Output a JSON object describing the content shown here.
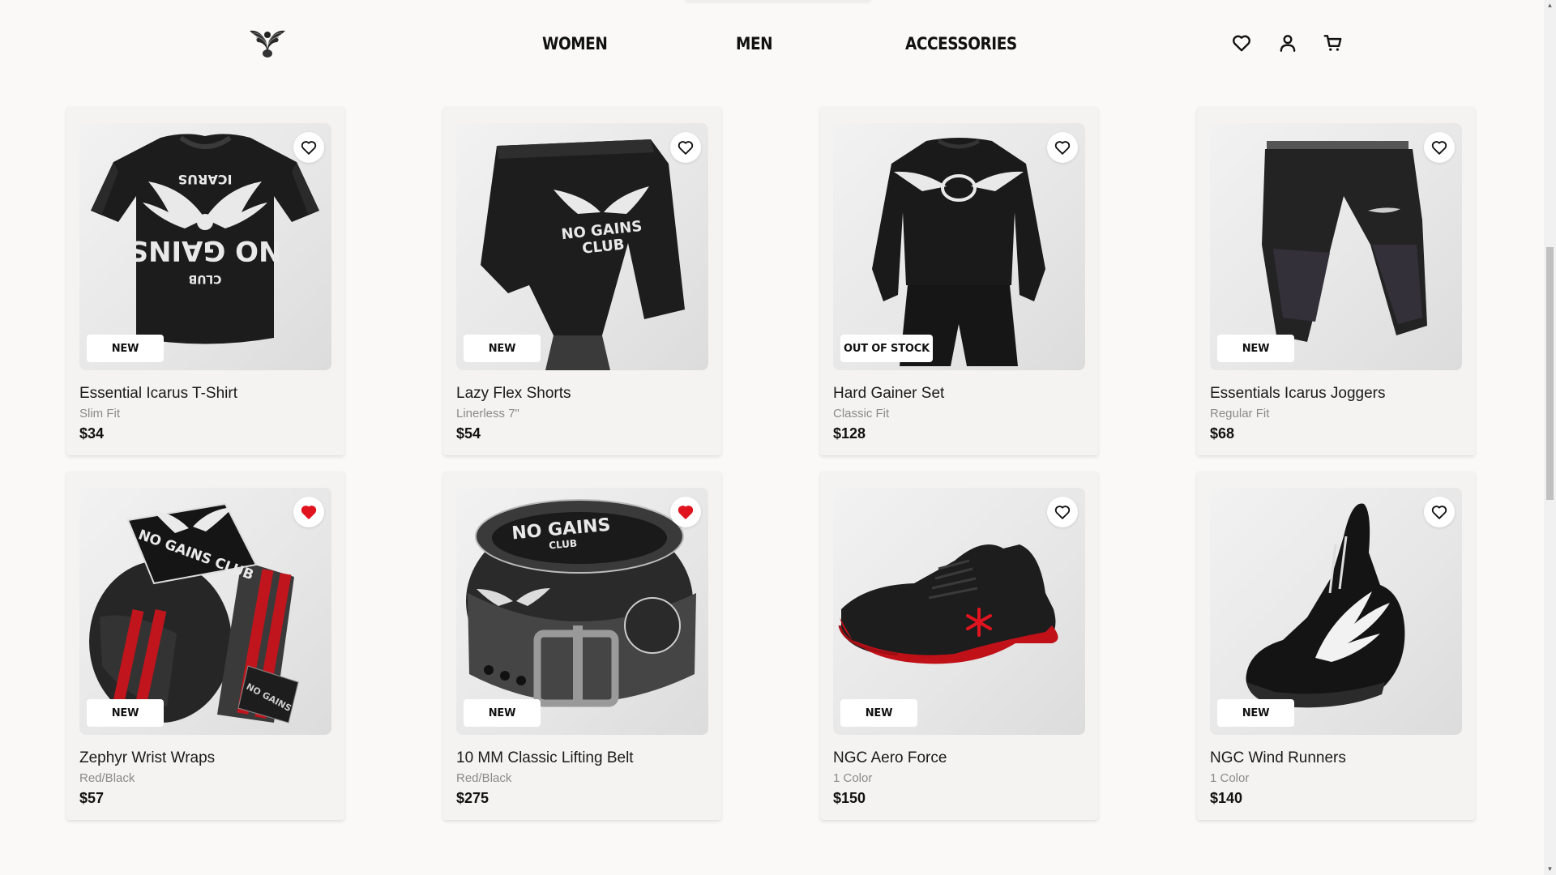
{
  "nav": {
    "logo": "eagle-logo",
    "links": [
      "WOMEN",
      "MEN",
      "ACCESSORIES"
    ],
    "icons": [
      "heart-icon",
      "user-icon",
      "cart-icon"
    ]
  },
  "products": [
    {
      "name": "Essential Icarus T-Shirt",
      "sub": "Slim Fit",
      "price": "$34",
      "badge": "NEW",
      "favorited": false
    },
    {
      "name": "Lazy Flex Shorts",
      "sub": "Linerless 7\"",
      "price": "$54",
      "badge": "NEW",
      "favorited": false
    },
    {
      "name": "Hard Gainer Set",
      "sub": "Classic Fit",
      "price": "$128",
      "badge": "OUT OF STOCK",
      "favorited": false
    },
    {
      "name": "Essentials Icarus Joggers",
      "sub": "Regular Fit",
      "price": "$68",
      "badge": "NEW",
      "favorited": false
    },
    {
      "name": "Zephyr Wrist Wraps",
      "sub": "Red/Black",
      "price": "$57",
      "badge": "NEW",
      "favorited": true
    },
    {
      "name": "10 MM Classic Lifting Belt",
      "sub": "Red/Black",
      "price": "$275",
      "badge": "NEW",
      "favorited": true
    },
    {
      "name": "NGC Aero Force",
      "sub": "1 Color",
      "price": "$150",
      "badge": "NEW",
      "favorited": false
    },
    {
      "name": "NGC Wind Runners",
      "sub": "1 Color",
      "price": "$140",
      "badge": "NEW",
      "favorited": false
    }
  ],
  "product_print": {
    "tshirt": [
      "ICARUS",
      "NO GAINS",
      "CLUB"
    ],
    "shorts": [
      "NO GAINS",
      "CLUB"
    ],
    "wraps": [
      "NO GAINS CLUB",
      "NO GAINS"
    ],
    "belt": [
      "NO GAINS",
      "CLUB"
    ]
  },
  "colors": {
    "accent_red": "#e0141e",
    "text": "#111111",
    "muted": "#8a8a8a"
  }
}
